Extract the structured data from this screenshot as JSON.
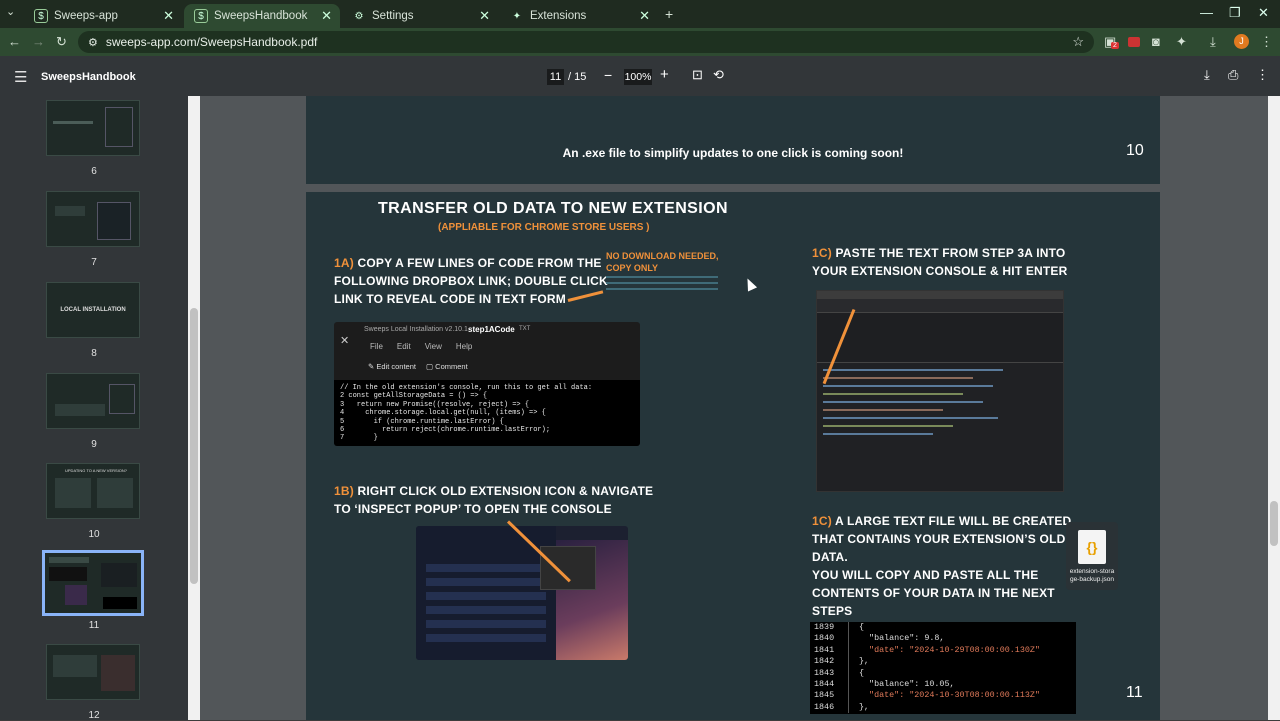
{
  "browser": {
    "tabs": [
      {
        "title": "Sweeps-app",
        "active": false
      },
      {
        "title": "SweepsHandbook",
        "active": true
      },
      {
        "title": "Settings",
        "active": false
      },
      {
        "title": "Extensions",
        "active": false
      }
    ],
    "url": "sweeps-app.com/SweepsHandbook.pdf",
    "profile_initial": "J",
    "badge_count": "2"
  },
  "pdf": {
    "title": "SweepsHandbook",
    "current_page": "11",
    "total_pages": "/ 15",
    "zoom": "100%"
  },
  "thumbnails": [
    {
      "num": "6",
      "label": ""
    },
    {
      "num": "7",
      "label": ""
    },
    {
      "num": "8",
      "label": "LOCAL INSTALLATION"
    },
    {
      "num": "9",
      "label": ""
    },
    {
      "num": "10",
      "label": "UPDATING TO A NEW VERSION?"
    },
    {
      "num": "11",
      "label": "",
      "selected": true
    },
    {
      "num": "12",
      "label": ""
    }
  ],
  "page10": {
    "text": "An .exe file to simplify updates to one click is coming soon!",
    "num": "10"
  },
  "page11": {
    "title": "TRANSFER OLD DATA TO NEW EXTENSION",
    "subtitle": "(APPLIABLE FOR CHROME STORE USERS )",
    "step1a_num": "1A)",
    "step1a_line1": " COPY A FEW LINES OF CODE FROM THE",
    "step1a_line2": "FOLLOWING DROPBOX LINK; DOUBLE CLICK",
    "step1a_line3": "LINK TO REVEAL CODE IN TEXT FORM",
    "no_download_1": "NO DOWNLOAD NEEDED,",
    "no_download_2": "COPY ONLY",
    "step1b_num": "1B)",
    "step1b_line1": " RIGHT CLICK OLD EXTENSION ICON & NAVIGATE",
    "step1b_line2": "TO ‘INSPECT POPUP’ TO OPEN THE CONSOLE",
    "step1c_num": "1C)",
    "step1c_line1": " PASTE THE TEXT FROM STEP 3A INTO",
    "step1c_line2": "YOUR EXTENSION CONSOLE & HIT ENTER",
    "step1c2_num": "1C)",
    "step1c2_line1": " A LARGE TEXT FILE WILL BE CREATED",
    "step1c2_line2": "THAT CONTAINS YOUR EXTENSION’S OLD",
    "step1c2_line3": "DATA.",
    "step1c2_line4": "YOU WILL COPY AND PASTE ALL THE",
    "step1c2_line5": "CONTENTS OF YOUR DATA IN THE NEXT",
    "step1c2_line6": "STEPS",
    "file_label_1": "extension-stora",
    "file_label_2": "ge-backup.json",
    "num": "11"
  },
  "dropbox": {
    "doc_title": "Sweeps Local Installation v2.10.1",
    "file_name": "step1ACode",
    "file_ext": "TXT",
    "menu": [
      "File",
      "Edit",
      "View",
      "Help"
    ],
    "edit_content": "Edit content",
    "comment": "Comment",
    "code": [
      "// In the old extension's console, run this to get all data:",
      "2 const getAllStorageData = () => {",
      "3   return new Promise((resolve, reject) => {",
      "4     chrome.storage.local.get(null, (items) => {",
      "5       if (chrome.runtime.lastError) {",
      "6         return reject(chrome.runtime.lastError);",
      "7       }"
    ]
  },
  "json_preview": {
    "lines": [
      {
        "n": "1839",
        "t": "{"
      },
      {
        "n": "1840",
        "t": "  \"balance\": 9.8,"
      },
      {
        "n": "1841",
        "t": "  \"date\": \"2024-10-29T08:00:00.130Z\""
      },
      {
        "n": "1842",
        "t": "},"
      },
      {
        "n": "1843",
        "t": "{"
      },
      {
        "n": "1844",
        "t": "  \"balance\": 10.05,"
      },
      {
        "n": "1845",
        "t": "  \"date\": \"2024-10-30T08:00:00.113Z\""
      },
      {
        "n": "1846",
        "t": "},"
      }
    ]
  },
  "colors": {
    "accent_orange": "#f0913a",
    "page_bg": "#25353a",
    "tab_bar": "#1f2b20"
  }
}
